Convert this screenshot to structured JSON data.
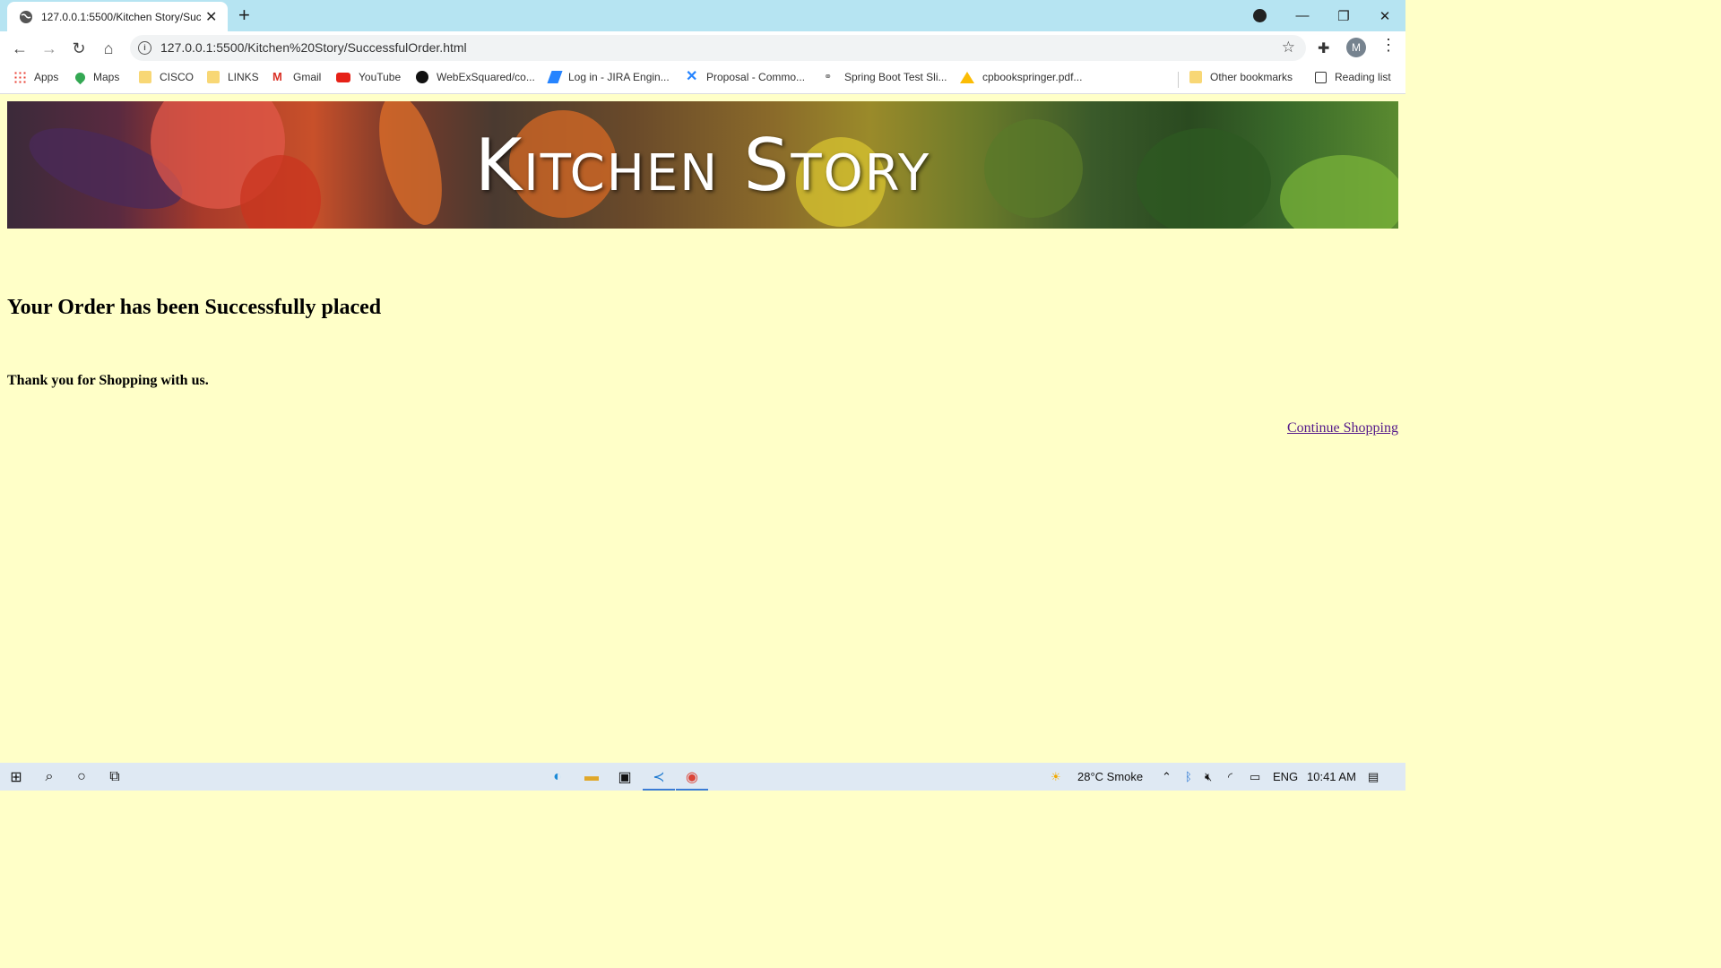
{
  "browser": {
    "tab_title": "127.0.0.1:5500/Kitchen Story/Suc",
    "url": "127.0.0.1:5500/Kitchen%20Story/SuccessfulOrder.html",
    "profile_initial": "M",
    "bookmarks": [
      {
        "label": "Apps",
        "icon": "apps-grid-icon"
      },
      {
        "label": "Maps",
        "icon": "maps-pin-icon"
      },
      {
        "label": "CISCO",
        "icon": "folder-icon"
      },
      {
        "label": "LINKS",
        "icon": "folder-icon"
      },
      {
        "label": "Gmail",
        "icon": "gmail-icon"
      },
      {
        "label": "YouTube",
        "icon": "youtube-icon"
      },
      {
        "label": "WebExSquared/co...",
        "icon": "github-icon"
      },
      {
        "label": "Log in - JIRA Engin...",
        "icon": "jira-icon"
      },
      {
        "label": "Proposal - Commo...",
        "icon": "confluence-icon"
      },
      {
        "label": "Spring Boot Test Sli...",
        "icon": "link-icon"
      },
      {
        "label": "cpbookspringer.pdf...",
        "icon": "drive-icon"
      }
    ],
    "other_bookmarks": "Other bookmarks",
    "reading_list": "Reading list"
  },
  "page": {
    "banner_title": "Kitchen Story",
    "heading": "Your Order has been Successfully placed",
    "subheading": "Thank you for Shopping with us.",
    "continue_link": "Continue Shopping"
  },
  "taskbar": {
    "weather": "28°C  Smoke",
    "language": "ENG",
    "time": "10:41 AM"
  },
  "colors": {
    "page_background": "#ffffc8",
    "link": "#551a8b",
    "tab_strip": "#b6e4f2"
  }
}
